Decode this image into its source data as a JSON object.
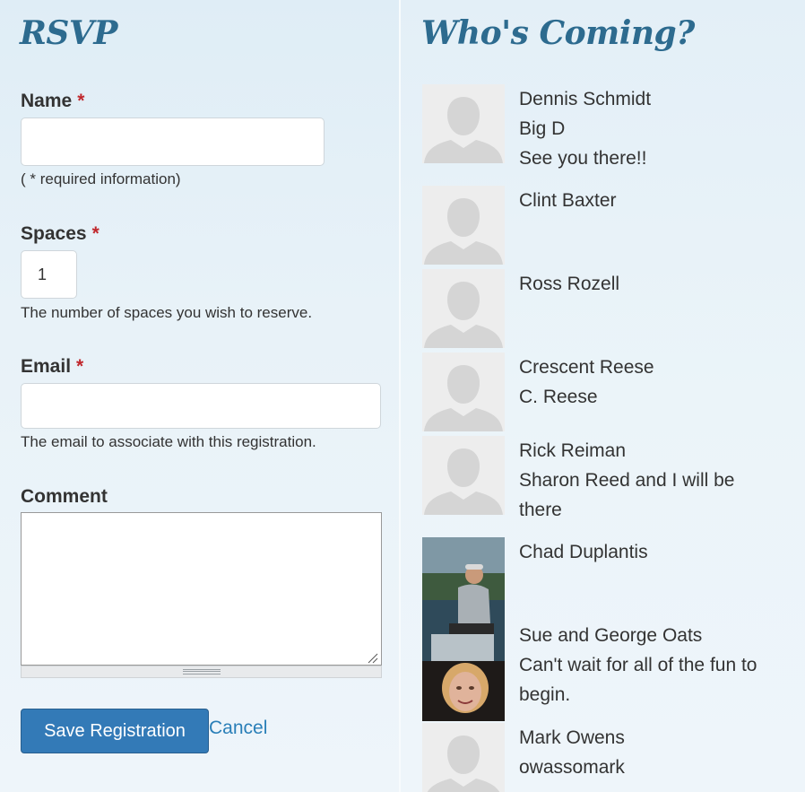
{
  "rsvp": {
    "title": "RSVP",
    "name": {
      "label": "Name",
      "required_mark": "*",
      "value": "",
      "help": "( * required information)"
    },
    "spaces": {
      "label": "Spaces",
      "required_mark": "*",
      "value": "1",
      "help": "The number of spaces you wish to reserve."
    },
    "email": {
      "label": "Email",
      "required_mark": "*",
      "value": "",
      "help": "The email to associate with this registration."
    },
    "comment": {
      "label": "Comment",
      "value": ""
    },
    "save_label": "Save Registration",
    "cancel_label": "Cancel"
  },
  "attendees": {
    "title": "Who's Coming?",
    "list": [
      {
        "name": "Dennis Schmidt",
        "lines": [
          "Big D",
          "See you there!!"
        ],
        "avatar": "default-avatar"
      },
      {
        "name": "Clint Baxter",
        "lines": [],
        "avatar": "default-avatar"
      },
      {
        "name": "Ross Rozell",
        "lines": [],
        "avatar": "default-avatar"
      },
      {
        "name": "Crescent Reese",
        "lines": [
          "C. Reese"
        ],
        "avatar": "default-avatar"
      },
      {
        "name": "Rick Reiman",
        "lines": [
          "Sharon Reed and I will be",
          "there"
        ],
        "avatar": "default-avatar"
      },
      {
        "name": "Chad Duplantis",
        "lines": [],
        "avatar": "photo-man-on-boat"
      },
      {
        "name": "Sue and George Oats",
        "lines": [
          "Can't wait for all of the fun to",
          "begin."
        ],
        "avatar": "photo-woman-portrait"
      },
      {
        "name": "Mark Owens",
        "lines": [
          "owassomark"
        ],
        "avatar": "default-avatar"
      }
    ]
  },
  "colors": {
    "heading": "#2d6b8f",
    "required": "#c0282d",
    "button": "#337ab7",
    "link": "#2a7fb8"
  }
}
